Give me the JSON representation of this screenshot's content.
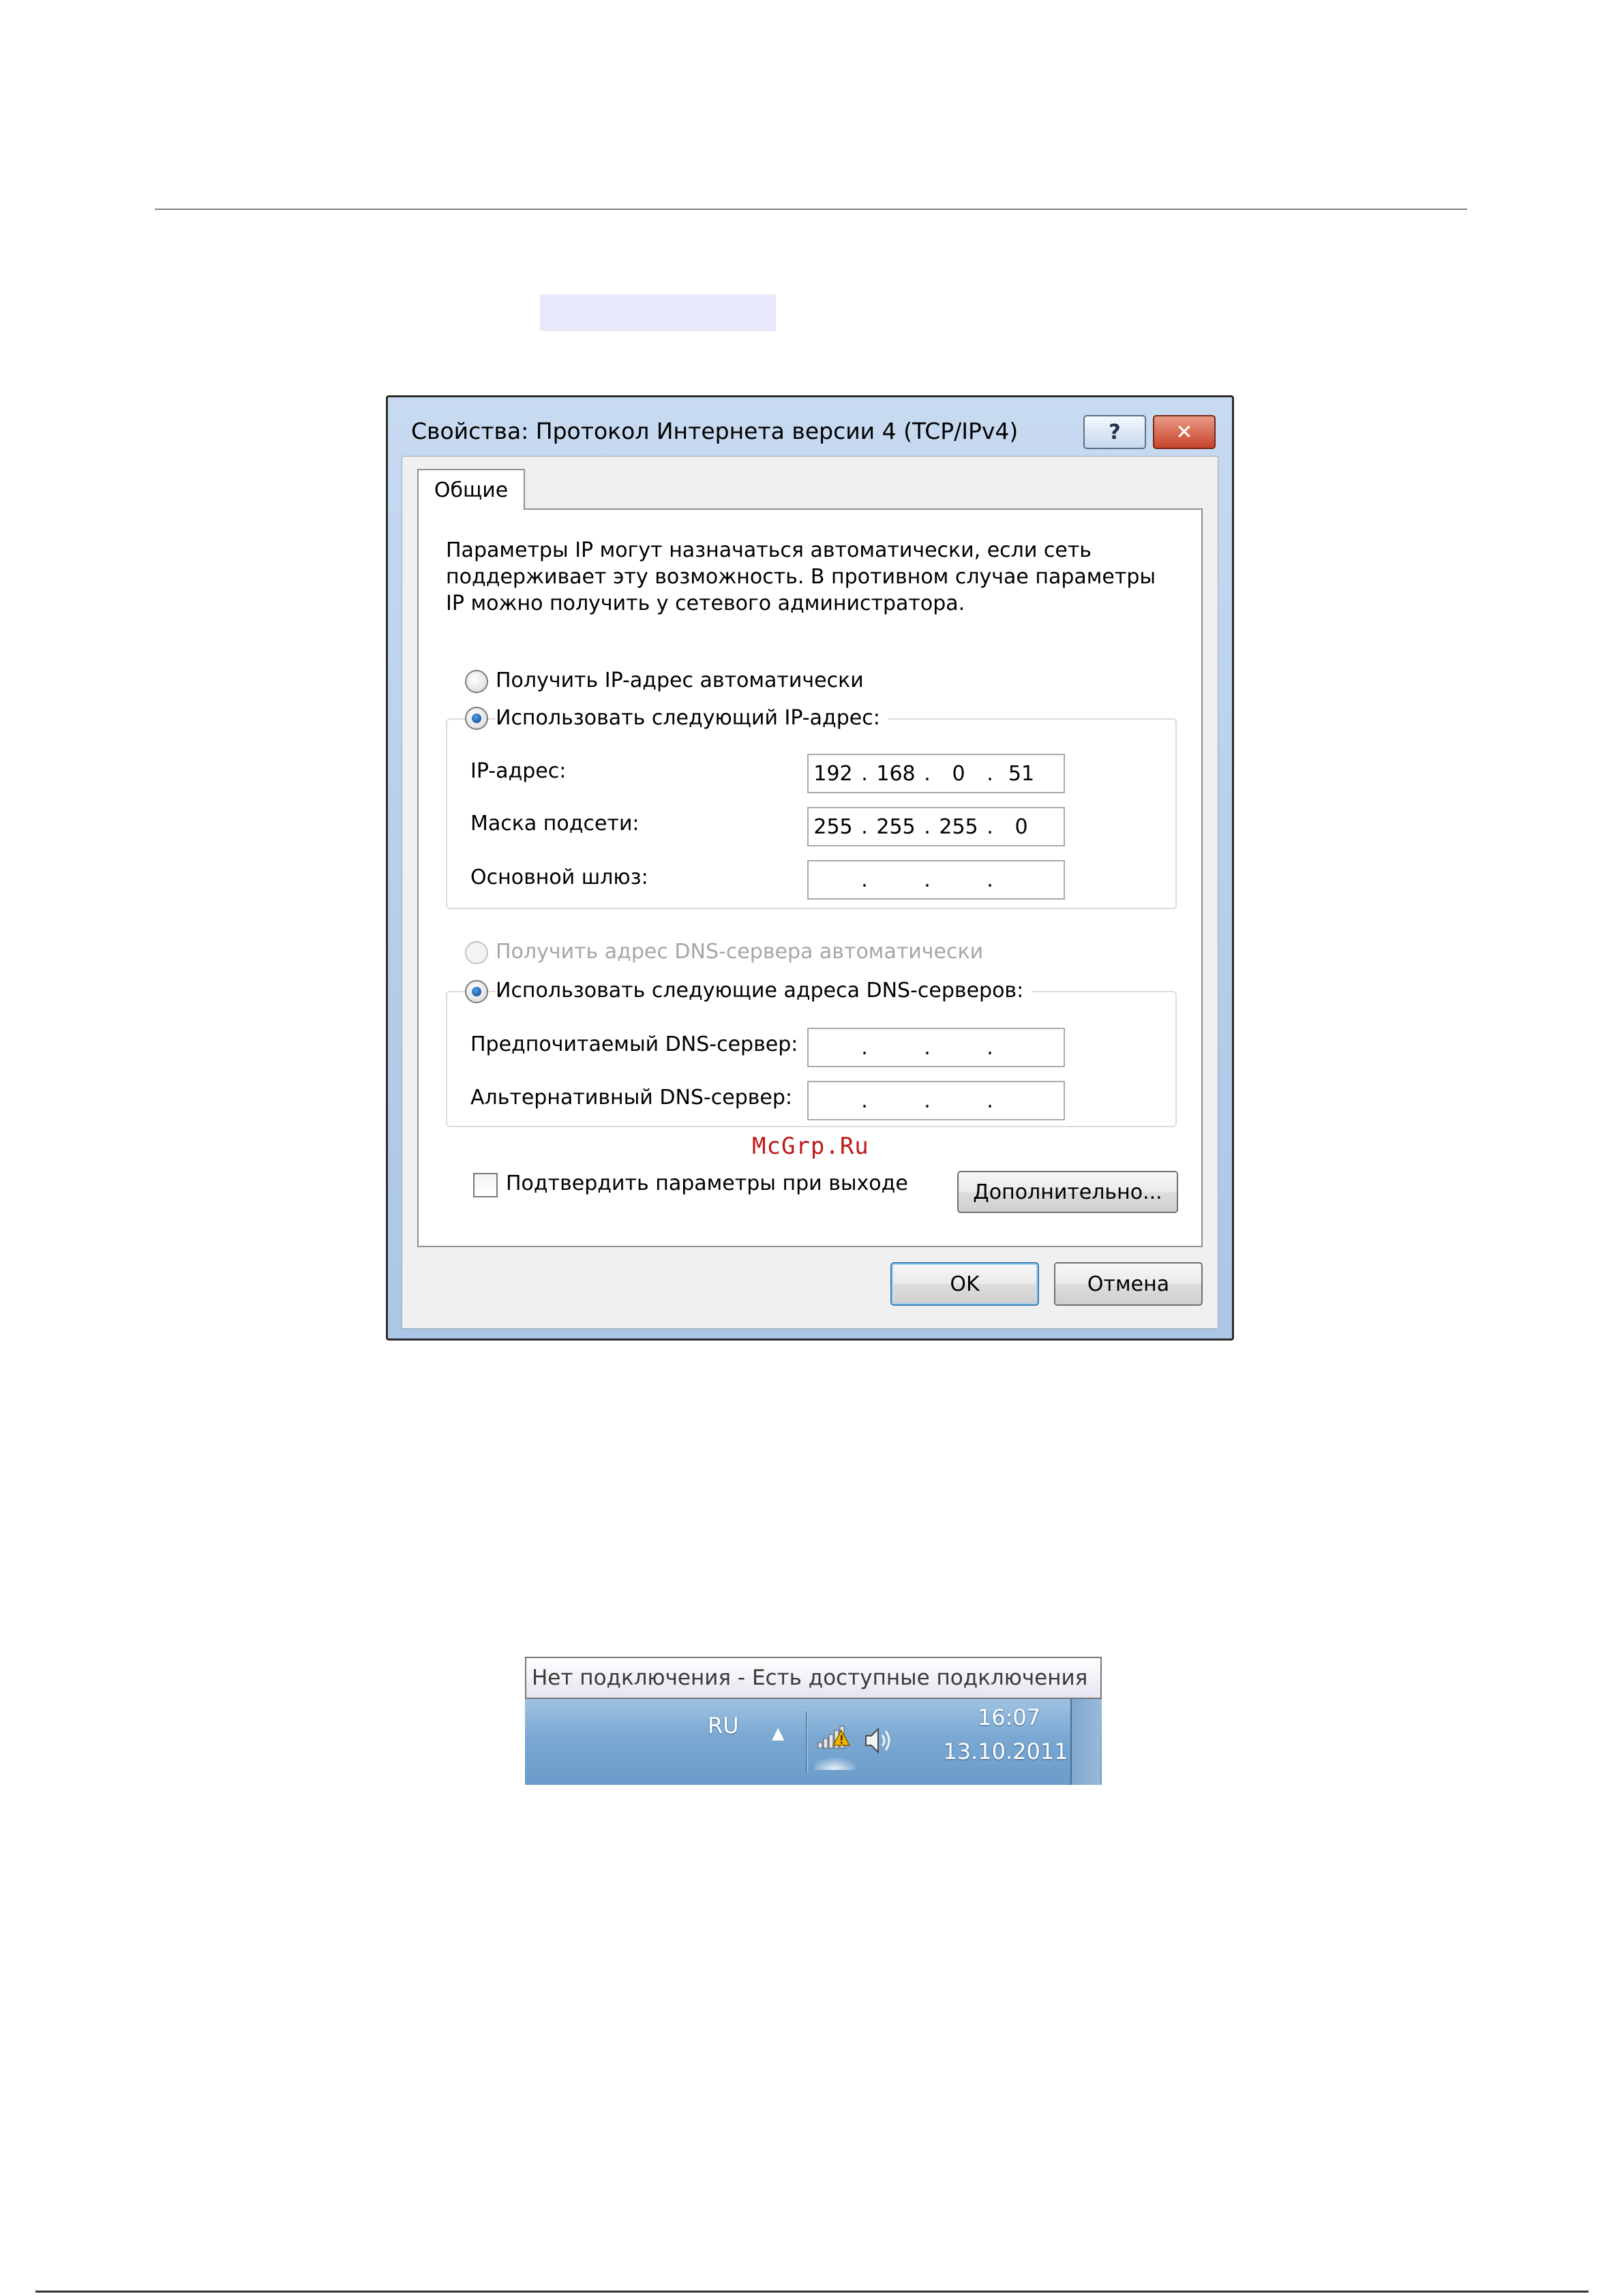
{
  "dialog": {
    "title": "Свойства: Протокол Интернета версии 4 (TCP/IPv4)",
    "help_label": "?",
    "close_label": "✕",
    "tab_label": "Общие",
    "intro_text": "Параметры IP могут назначаться автоматически, если сеть\nподдерживает эту возможность. В противном случае параметры\nIP можно получить у сетевого администратора.",
    "ip_section": {
      "auto_option": "Получить IP-адрес автоматически",
      "manual_option": "Использовать следующий IP-адрес:",
      "selected": "manual",
      "fields": [
        {
          "label": "IP-адрес:",
          "octets": [
            "192",
            "168",
            "0",
            "51"
          ]
        },
        {
          "label": "Маска подсети:",
          "octets": [
            "255",
            "255",
            "255",
            "0"
          ]
        },
        {
          "label": "Основной шлюз:",
          "octets": [
            "",
            "",
            "",
            ""
          ]
        }
      ]
    },
    "dns_section": {
      "auto_option": "Получить адрес DNS-сервера автоматически",
      "manual_option": "Использовать следующие адреса DNS-серверов:",
      "selected": "manual",
      "fields": [
        {
          "label": "Предпочитаемый DNS-сервер:",
          "octets": [
            "",
            "",
            "",
            ""
          ]
        },
        {
          "label": "Альтернативный DNS-сервер:",
          "octets": [
            "",
            "",
            "",
            ""
          ]
        }
      ]
    },
    "confirm_checkbox": {
      "label": "Подтвердить параметры при выходе",
      "checked": false
    },
    "advanced_button": "Дополнительно...",
    "ok_button": "OK",
    "cancel_button": "Отмена"
  },
  "watermark": "McGrp.Ru",
  "tray": {
    "tooltip": "Нет подключения - Есть доступные подключения",
    "language": "RU",
    "show_hidden_icons": "▲",
    "time": "16:07",
    "date": "13.10.2011"
  },
  "icons": [
    "help-icon",
    "close-icon",
    "arrow-up-icon",
    "network-warning-icon",
    "speaker-icon"
  ]
}
